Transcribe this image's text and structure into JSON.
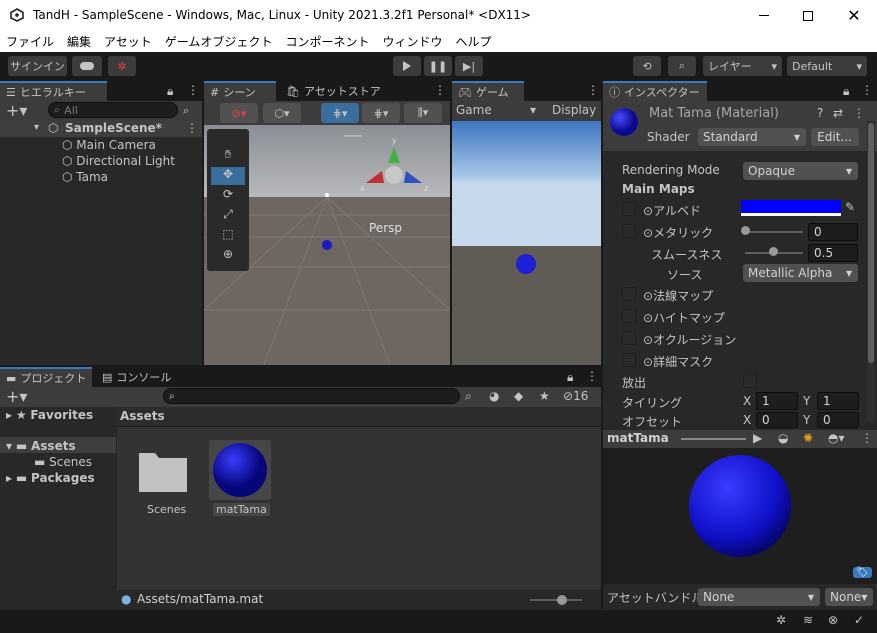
{
  "window": {
    "title": "TandH - SampleScene - Windows, Mac, Linux - Unity 2021.3.2f1 Personal* <DX11>"
  },
  "menu": [
    "ファイル",
    "編集",
    "アセット",
    "ゲームオブジェクト",
    "コンポーネント",
    "ウィンドウ",
    "ヘルプ"
  ],
  "toolbar": {
    "signin": "サインイン",
    "layers": "レイヤー",
    "layout": "Default"
  },
  "hierarchy": {
    "tab": "ヒエラルキー",
    "search_placeholder": "All",
    "scene": "SampleScene*",
    "items": [
      "Main Camera",
      "Directional Light",
      "Tama"
    ]
  },
  "scene_tab": {
    "tab": "シーン",
    "persp": "Persp"
  },
  "asset_store": {
    "tab": "アセットストア"
  },
  "game": {
    "tab": "ゲーム",
    "mode": "Game",
    "display": "Display"
  },
  "inspector": {
    "tab": "インスペクター",
    "material": "Mat Tama (Material)",
    "shader_label": "Shader",
    "shader_value": "Standard",
    "edit_button": "Edit...",
    "rendering_mode_label": "Rendering Mode",
    "rendering_mode_value": "Opaque",
    "main_maps": "Main Maps",
    "albedo": "アルベド",
    "albedo_color": "#0000ff",
    "metallic": "メタリック",
    "metallic_value": "0",
    "smoothness": "スムースネス",
    "smoothness_value": "0.5",
    "source": "ソース",
    "source_value": "Metallic Alpha",
    "normal_map": "法線マップ",
    "height_map": "ハイトマップ",
    "occlusion": "オクルージョン",
    "detail_mask": "詳細マスク",
    "emission": "放出",
    "tiling": "タイリング",
    "tiling_x": "1",
    "tiling_y": "1",
    "offset": "オフセット",
    "offset_x": "0",
    "offset_y": "0",
    "x_label": "X",
    "y_label": "Y",
    "preview_name": "matTama",
    "asset_bundle_label": "アセットバンドル",
    "asset_bundle_value": "None",
    "asset_bundle_variant": "None"
  },
  "project": {
    "tab": "プロジェクト",
    "console_tab": "コンソール",
    "hidden_count": "16",
    "tree": {
      "favorites": "Favorites",
      "assets": "Assets",
      "scenes": "Scenes",
      "packages": "Packages"
    },
    "breadcrumb": "Assets",
    "assets": [
      {
        "name": "Scenes",
        "icon": "folder-icon"
      },
      {
        "name": "matTama",
        "icon": "material-sphere-icon"
      }
    ],
    "path": "Assets/matTama.mat"
  },
  "colors": {
    "accent": "#3a79bb",
    "material_blue": "#0000ff",
    "selection": "#2c5d87"
  }
}
